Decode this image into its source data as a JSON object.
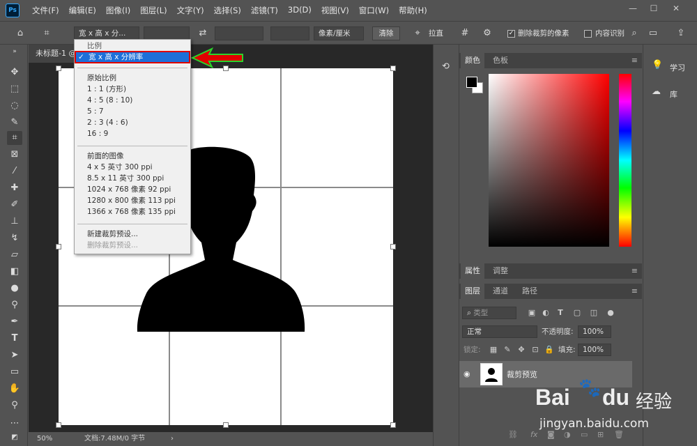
{
  "app": {
    "logo_text": "Ps"
  },
  "menu": [
    "文件(F)",
    "编辑(E)",
    "图像(I)",
    "图层(L)",
    "文字(Y)",
    "选择(S)",
    "滤镜(T)",
    "3D(D)",
    "视图(V)",
    "窗口(W)",
    "帮助(H)"
  ],
  "window_controls": {
    "minimize": "—",
    "maximize": "☐",
    "close": "✕"
  },
  "options_bar": {
    "ratio_select": "宽 x 高 x 分...",
    "unit_select": "像素/厘米",
    "clear_label": "清除",
    "straighten_label": "拉直",
    "delete_cropped_label": "删除裁剪的像素",
    "delete_cropped_checked": true,
    "content_aware_label": "内容识别",
    "content_aware_checked": false
  },
  "document": {
    "tab_title": "未标题-1 @",
    "zoom": "50%",
    "doc_info": "文档:7.48M/0 字节"
  },
  "dropdown": {
    "header": "比例",
    "selected": "宽 x 高 x 分辨率",
    "group1_title": "原始比例",
    "ratios": [
      "1 : 1 (方形)",
      "4 : 5 (8 : 10)",
      "5 : 7",
      "2 : 3 (4 : 6)",
      "16 : 9"
    ],
    "group2_title": "前面的图像",
    "presets": [
      "4 x 5 英寸 300 ppi",
      "8.5 x 11 英寸 300 ppi",
      "1024 x 768 像素 92 ppi",
      "1280 x 800 像素 113 ppi",
      "1366 x 768 像素 135 ppi"
    ],
    "new_preset": "新建裁剪预设...",
    "delete_preset": "删除裁剪预设..."
  },
  "color_panel": {
    "tabs": [
      "颜色",
      "色板"
    ]
  },
  "props_panel": {
    "tabs": [
      "属性",
      "调整"
    ]
  },
  "layers_panel": {
    "tabs": [
      "图层",
      "通道",
      "路径"
    ],
    "filter_placeholder": "类型",
    "blend_mode": "正常",
    "opacity_label": "不透明度:",
    "opacity_value": "100%",
    "lock_label": "锁定:",
    "fill_label": "填充:",
    "fill_value": "100%",
    "layer_name": "裁剪预览"
  },
  "far_panel": {
    "learn": "学习",
    "library": "库"
  },
  "watermark": {
    "brand": "Bai",
    "brand2": "du",
    "cn": "经验",
    "url": "jingyan.baidu.com"
  }
}
